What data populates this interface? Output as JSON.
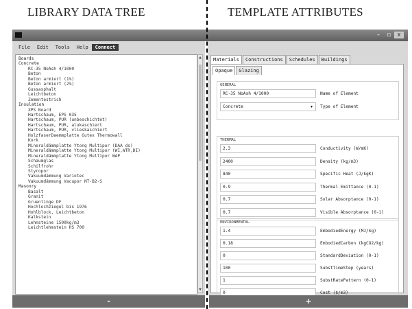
{
  "captions": {
    "left": "LIBRARY DATA TREE",
    "right": "TEMPLATE ATTRIBUTES"
  },
  "window": {
    "buttons": {
      "minimize": "–",
      "maximize": "▫",
      "close": "x"
    }
  },
  "menu": {
    "file": "File",
    "edit": "Edit",
    "tools": "Tools",
    "help": "Help",
    "connect": "Connect"
  },
  "tree": {
    "categories": [
      {
        "label": "Boards",
        "items": []
      },
      {
        "label": "Concrete",
        "items": [
          "RC-35 NoAsh 4/1000",
          "Beton",
          "Beton armiert (1%)",
          "Beton armiert (2%)",
          "Gussasphalt",
          "Leichtbeton",
          "Zementestrich"
        ]
      },
      {
        "label": "Insulation",
        "items": [
          "XPS Board",
          "Hartschaum, EPS 035",
          "Hartschaum, PUR (unbeschichtet)",
          "Hartschaum, PUR, alukaschiert",
          "Hartschaum, PUR, vlieskaschiert",
          "HolzfaserDaemmplatte Gutex Thermowall",
          "Kork",
          "Mineraldämmplatte Ytong Multipor (DAA ds)",
          "Mineraldämmplatte Ytong Multipor (WI,WTR,DI)",
          "Mineraldämmplatte Ytong Multipor WAP",
          "Schaumglas",
          "Schilfrohr",
          "Styropor",
          "Vakuumdämmung Variotec",
          "Vakuumdämmung Vacupor  NT-B2-S"
        ]
      },
      {
        "label": "Masonry",
        "items": [
          "Basalt",
          "Granit",
          "Gruenlinge DF",
          "Hochlochziegel bis 1976",
          "Hohlblock, Leichtbeton",
          "Kalkstein",
          "Lehmsteine 1500kg/m3",
          "Leichtlehmstein HS  700"
        ]
      }
    ]
  },
  "buttons": {
    "remove": "-",
    "add": "+"
  },
  "tabs": [
    "Materials",
    "Constructions",
    "Schedules",
    "Buildings"
  ],
  "subtabs": [
    "Opaque",
    "Glazing"
  ],
  "general": {
    "title": "GENERAL",
    "rows": [
      {
        "value": "RC-35 NoAsh 4/1000",
        "label": "Name of Element"
      },
      {
        "value": "Concrete",
        "label": "Type of Element"
      }
    ]
  },
  "thermal": {
    "title": "THERMAL",
    "rows": [
      {
        "value": "2.3",
        "label": "Conductivity (W/mK)"
      },
      {
        "value": "2400",
        "label": "Density (kg/m3)"
      },
      {
        "value": "840",
        "label": "Specific Heat (J/kgK)"
      },
      {
        "value": "0.9",
        "label": "Thermal Emittance (0-1)"
      },
      {
        "value": "0.7",
        "label": "Solar Absorptance (0-1)"
      },
      {
        "value": "0.7",
        "label": "Visible Absorptance (0-1)"
      }
    ]
  },
  "environmental": {
    "title": "ENVIRONMENTAL",
    "rows": [
      {
        "value": "1.4",
        "label": "EmbodiedEnergy (MJ/kg)"
      },
      {
        "value": "0.18",
        "label": "EmbodiedCarbon (kgCO2/kg)"
      },
      {
        "value": "0",
        "label": "StandardDeviation (0-1)"
      },
      {
        "value": "100",
        "label": "SubstTimeStep (years)"
      },
      {
        "value": "1",
        "label": "SubstRatePattern (0-1)"
      },
      {
        "value": "0",
        "label": "Cost ($/m3)"
      }
    ]
  }
}
